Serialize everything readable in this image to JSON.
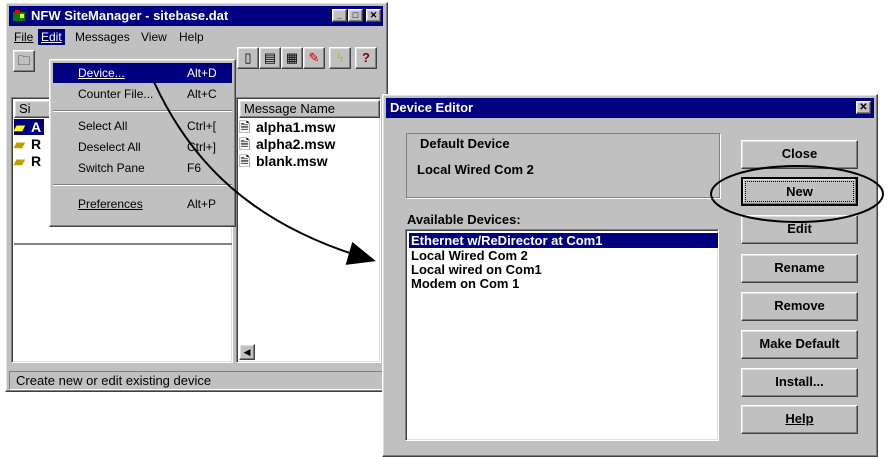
{
  "main_window": {
    "title": "NFW SiteManager - sitebase.dat",
    "title_buttons": {
      "minimize": "_",
      "maximize": "□",
      "close": "✕"
    },
    "menu": [
      "File",
      "Edit",
      "Messages",
      "View",
      "Help"
    ],
    "active_menu": "Edit",
    "toolbar_icons": [
      "open-folder",
      "page",
      "page-text",
      "image",
      "pencil",
      "lightning",
      "help"
    ],
    "left_pane": {
      "column_header": "Si",
      "rows": [
        {
          "label": "A",
          "icon": "open-folder"
        },
        {
          "label": "R",
          "icon": "folder"
        },
        {
          "label": "R",
          "icon": "folder"
        }
      ]
    },
    "right_pane": {
      "column_header": "Message Name",
      "files": [
        "alpha1.msw",
        "alpha2.msw",
        "blank.msw"
      ]
    },
    "status": "Create new or edit existing device"
  },
  "edit_menu": {
    "items": [
      {
        "label": "Device...",
        "shortcut": "Alt+D",
        "highlighted": true
      },
      {
        "label": "Counter File...",
        "shortcut": "Alt+C"
      },
      {
        "label": "Select All",
        "shortcut": "Ctrl+["
      },
      {
        "label": "Deselect All",
        "shortcut": "Ctrl+]"
      },
      {
        "label": "Switch Pane",
        "shortcut": "F6"
      },
      {
        "label": "Preferences",
        "shortcut": "Alt+P"
      }
    ]
  },
  "device_editor": {
    "title": "Device Editor",
    "close_glyph": "✕",
    "default_group_label": "Default Device",
    "default_device": "Local Wired Com 2",
    "available_label": "Available Devices:",
    "devices": [
      "Ethernet w/ReDirector at Com1",
      "Local Wired Com 2",
      "Local wired on Com1",
      "Modem on Com 1"
    ],
    "selected_index": 0,
    "buttons": [
      "Close",
      "New",
      "Edit",
      "Rename",
      "Remove",
      "Make Default",
      "Install...",
      "Help"
    ],
    "focused_button": "New"
  },
  "colors": {
    "titlebar": "#000080",
    "face": "#c0c0c0",
    "highlight": "#000080"
  }
}
